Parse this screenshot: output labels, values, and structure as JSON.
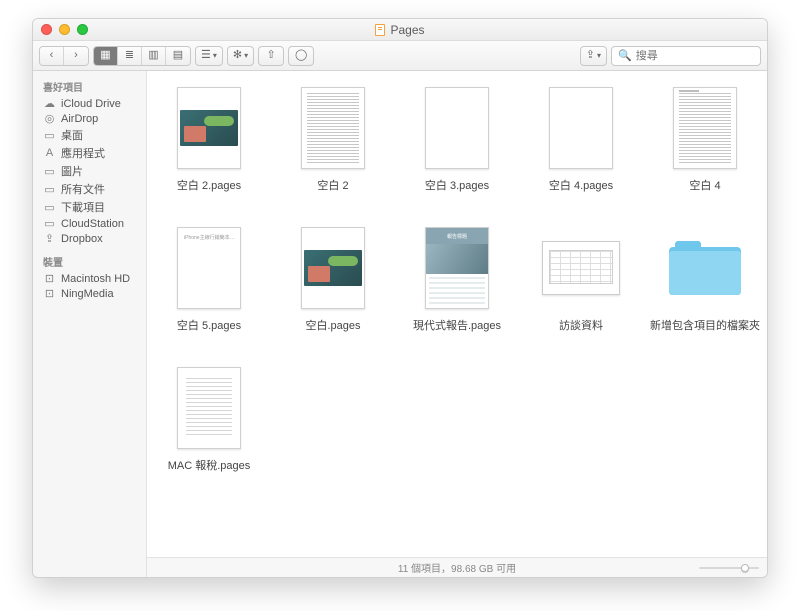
{
  "window": {
    "title": "Pages"
  },
  "toolbar": {
    "views": [
      "icon",
      "list",
      "column",
      "coverflow"
    ],
    "active_view": "icon",
    "search_placeholder": "搜尋"
  },
  "sidebar": {
    "favorites_label": "喜好項目",
    "favorites": [
      {
        "icon": "☁",
        "label": "iCloud Drive"
      },
      {
        "icon": "◎",
        "label": "AirDrop"
      },
      {
        "icon": "▭",
        "label": "桌面"
      },
      {
        "icon": "A",
        "label": "應用程式"
      },
      {
        "icon": "▭",
        "label": "圖片"
      },
      {
        "icon": "▭",
        "label": "所有文件"
      },
      {
        "icon": "▭",
        "label": "下載項目"
      },
      {
        "icon": "▭",
        "label": "CloudStation"
      },
      {
        "icon": "⇪",
        "label": "Dropbox"
      }
    ],
    "devices_label": "裝置",
    "devices": [
      {
        "icon": "⊡",
        "label": "Macintosh HD"
      },
      {
        "icon": "⊡",
        "label": "NingMedia"
      }
    ]
  },
  "files": [
    {
      "name": "空白 2.pages",
      "kind": "slide-doc"
    },
    {
      "name": "空白 2",
      "kind": "text-dense"
    },
    {
      "name": "空白 3.pages",
      "kind": "blank"
    },
    {
      "name": "空白 4.pages",
      "kind": "blank"
    },
    {
      "name": "空白 4",
      "kind": "text-dense2"
    },
    {
      "name": "空白 5.pages",
      "kind": "caption"
    },
    {
      "name": "空白.pages",
      "kind": "slide-doc"
    },
    {
      "name": "現代式報告.pages",
      "kind": "report"
    },
    {
      "name": "訪談資料",
      "kind": "spreadsheet"
    },
    {
      "name": "新增包含項目的檔案夾",
      "kind": "folder"
    },
    {
      "name": "MAC 報稅.pages",
      "kind": "text-block"
    }
  ],
  "status": {
    "text": "11 個項目，98.68 GB 可用",
    "zoom": 0.8
  }
}
